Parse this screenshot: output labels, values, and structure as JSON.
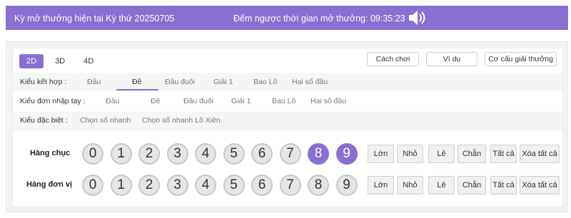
{
  "header": {
    "current_period": "Kỳ mở thưởng hiện tại Kỳ thứ 20250705",
    "countdown": "Đếm ngược thời gian mở thưởng: 09:35:23",
    "speaker_icon": "speaker-icon"
  },
  "tabs": [
    "2D",
    "3D",
    "4D"
  ],
  "active_tab": "2D",
  "top_buttons": [
    "Cách chơi",
    "Ví dụ",
    "Cơ cấu giải thưởng"
  ],
  "rows": {
    "combo": {
      "label": "Kiểu kết hợp :",
      "options": [
        "Đầu",
        "Đề",
        "Đầu đuôi",
        "Giải 1",
        "Bao Lô",
        "Hai số đầu"
      ],
      "active": "Đề"
    },
    "manual": {
      "label": "Kiểu đơn nhập tay :",
      "options": [
        "Đầu",
        "Đề",
        "Đầu đuôi",
        "Giải 1",
        "Bao Lô",
        "Hai số đầu"
      ]
    },
    "special": {
      "label": "Kiểu đặc biệt :",
      "options": [
        "Chọn số nhanh",
        "Chọn số nhanh Lô Xiên"
      ]
    }
  },
  "digit_rows": [
    {
      "label": "Hàng chục",
      "digits": [
        "0",
        "1",
        "2",
        "3",
        "4",
        "5",
        "6",
        "7",
        "8",
        "9"
      ],
      "selected": [
        "8",
        "9"
      ]
    },
    {
      "label": "Hàng đơn vị",
      "digits": [
        "0",
        "1",
        "2",
        "3",
        "4",
        "5",
        "6",
        "7",
        "8",
        "9"
      ],
      "selected": []
    }
  ],
  "quick_buttons": [
    "Lớn",
    "Nhỏ",
    "Lẻ",
    "Chẵn",
    "Tất cả",
    "Xóa tất cả"
  ],
  "colors": {
    "accent": "#8a6fd1",
    "ball": "#e6e6e6"
  }
}
